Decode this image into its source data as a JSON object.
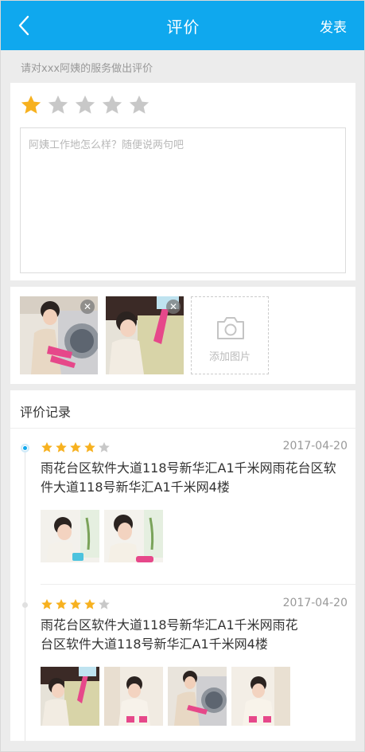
{
  "header": {
    "title": "评价",
    "publish_label": "发表"
  },
  "hint": "请对xxx阿姨的服务做出评价",
  "rating": {
    "value": 1,
    "max": 5,
    "active_color": "#f7b11f",
    "inactive_color": "#c8c8c8"
  },
  "comment": {
    "placeholder": "阿姨工作地怎么样？随便说两句吧",
    "value": ""
  },
  "photos": {
    "items": [
      "photo-washing-machine",
      "photo-cleaning-window"
    ],
    "add_label": "添加图片"
  },
  "records": {
    "title": "评价记录",
    "items": [
      {
        "rating": 4,
        "date": "2017-04-20",
        "address_line1": "雨花台区软件大道118号新华汇A1千米网雨花台区软",
        "address_line2": "件大道118号新华汇A1千米网4楼",
        "images": [
          "photo-cleaning-table",
          "photo-cleaning-table-2"
        ]
      },
      {
        "rating": 4,
        "date": "2017-04-20",
        "address_line1": "雨花台区软件大道118号新华汇A1千米网雨花",
        "address_line2": "台区软件大道118号新华汇A1千米网4楼",
        "images": [
          "photo-cleaning-window",
          "photo-cleaning-floor",
          "photo-washing-machine",
          "photo-cleaning-floor-2"
        ]
      }
    ]
  },
  "colors": {
    "brand": "#0fa8ee",
    "background": "#ececec"
  }
}
